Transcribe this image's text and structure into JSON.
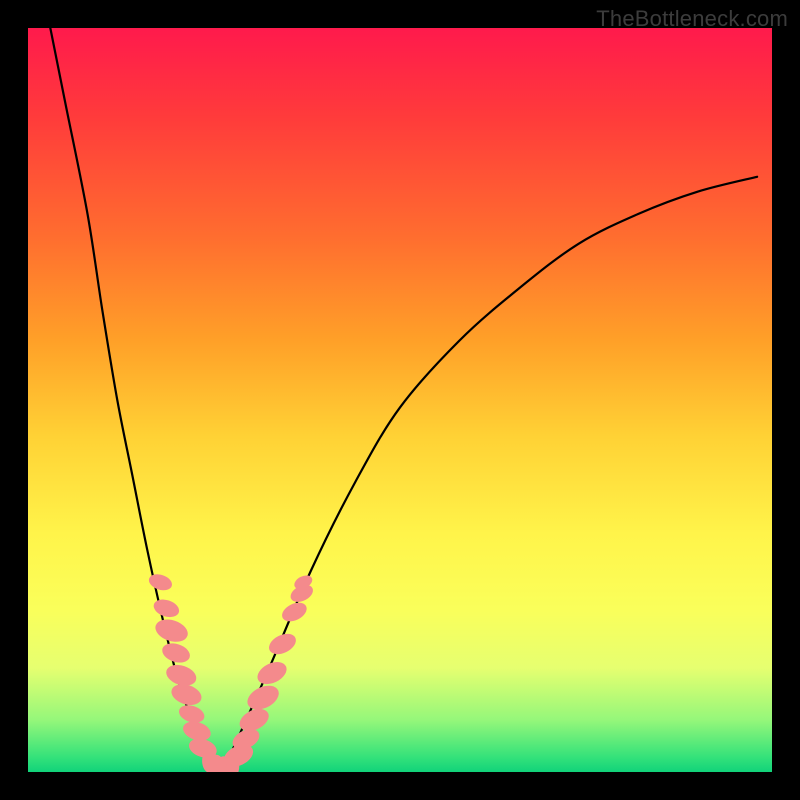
{
  "watermark": "TheBottleneck.com",
  "chart_data": {
    "type": "line",
    "title": "",
    "xlabel": "",
    "ylabel": "",
    "xlim": [
      0,
      100
    ],
    "ylim": [
      0,
      100
    ],
    "series": [
      {
        "name": "bottleneck-curve",
        "x": [
          3,
          5,
          8,
          10,
          12,
          14,
          16,
          18,
          20,
          22,
          24,
          25.5,
          27,
          32,
          38,
          44,
          50,
          58,
          66,
          74,
          82,
          90,
          98
        ],
        "y": [
          100,
          90,
          75,
          62,
          50,
          40,
          30,
          21,
          13,
          7,
          2,
          0,
          2,
          13,
          27,
          39,
          49,
          58,
          65,
          71,
          75,
          78,
          80
        ]
      }
    ],
    "markers": [
      {
        "x": 17.8,
        "y": 25.5,
        "r": 1.0
      },
      {
        "x": 18.6,
        "y": 22.0,
        "r": 1.1
      },
      {
        "x": 19.3,
        "y": 19.0,
        "r": 1.4
      },
      {
        "x": 19.9,
        "y": 16.0,
        "r": 1.2
      },
      {
        "x": 20.6,
        "y": 13.0,
        "r": 1.3
      },
      {
        "x": 21.3,
        "y": 10.4,
        "r": 1.3
      },
      {
        "x": 22.0,
        "y": 7.8,
        "r": 1.1
      },
      {
        "x": 22.7,
        "y": 5.5,
        "r": 1.2
      },
      {
        "x": 23.5,
        "y": 3.2,
        "r": 1.2
      },
      {
        "x": 24.4,
        "y": 1.5,
        "r": 1.0
      },
      {
        "x": 25.3,
        "y": 0.4,
        "r": 1.2
      },
      {
        "x": 26.3,
        "y": 0.2,
        "r": 1.2
      },
      {
        "x": 27.3,
        "y": 0.8,
        "r": 1.1
      },
      {
        "x": 28.3,
        "y": 2.2,
        "r": 1.3
      },
      {
        "x": 29.3,
        "y": 4.4,
        "r": 1.2
      },
      {
        "x": 30.4,
        "y": 7.0,
        "r": 1.3
      },
      {
        "x": 31.6,
        "y": 10.0,
        "r": 1.4
      },
      {
        "x": 32.8,
        "y": 13.3,
        "r": 1.3
      },
      {
        "x": 34.2,
        "y": 17.2,
        "r": 1.2
      },
      {
        "x": 35.8,
        "y": 21.5,
        "r": 1.1
      },
      {
        "x": 36.8,
        "y": 24.0,
        "r": 1.0
      },
      {
        "x": 37.0,
        "y": 25.5,
        "r": 0.8
      }
    ],
    "colors": {
      "curve": "#000000",
      "markers": "#f48a8c"
    }
  }
}
